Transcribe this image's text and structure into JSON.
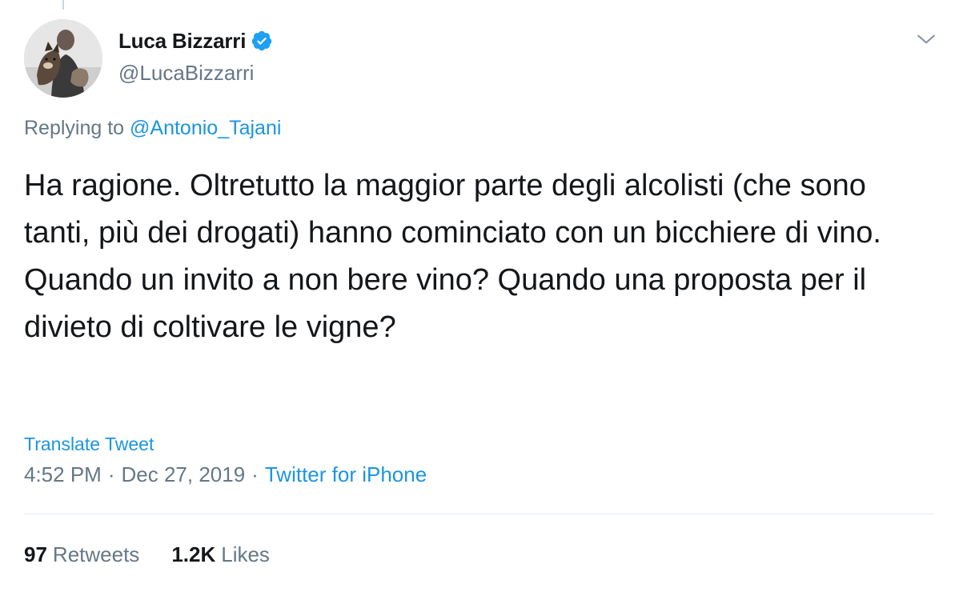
{
  "author": {
    "display_name": "Luca Bizzarri",
    "handle": "@LucaBizzarri",
    "verified": true,
    "verified_icon": "verified-badge-icon",
    "avatar": "profile-photo-man-with-dog"
  },
  "reply": {
    "prefix": "Replying to ",
    "to_handle": "@Antonio_Tajani"
  },
  "tweet": {
    "text": "Ha ragione. Oltretutto la maggior parte degli alcolisti (che sono tanti, più dei drogati) hanno cominciato con un bicchiere di vino.\nQuando un invito a non bere vino? Quando una proposta per il divieto di coltivare le vigne?",
    "translate_label": "Translate Tweet",
    "time": "4:52 PM",
    "separator": "·",
    "date": "Dec 27, 2019",
    "source": "Twitter for iPhone"
  },
  "stats": {
    "retweets_count": "97",
    "retweets_label": "Retweets",
    "likes_count": "1.2K",
    "likes_label": "Likes"
  },
  "menu": {
    "icon": "chevron-down-icon"
  },
  "colors": {
    "link": "#1b95e0",
    "secondary_text": "#657786",
    "primary_text": "#14171a",
    "verified": "#1da1f2",
    "divider": "#e1e8ed"
  }
}
